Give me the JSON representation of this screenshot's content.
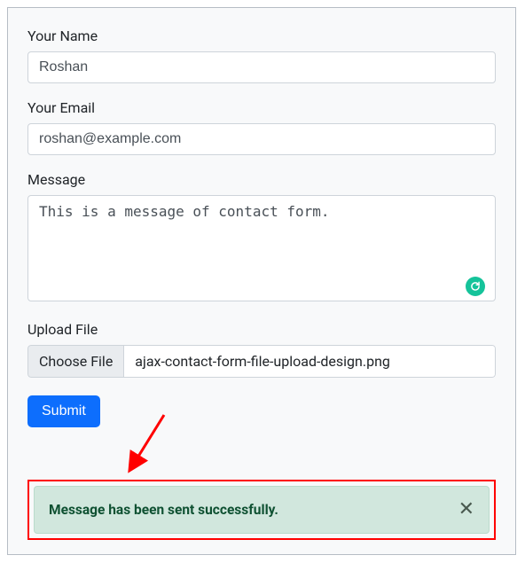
{
  "form": {
    "name": {
      "label": "Your Name",
      "value": "Roshan"
    },
    "email": {
      "label": "Your Email",
      "value": "roshan@example.com"
    },
    "message": {
      "label": "Message",
      "value": "This is a message of contact form."
    },
    "upload": {
      "label": "Upload File",
      "button": "Choose File",
      "filename": "ajax-contact-form-file-upload-design.png"
    },
    "submit": "Submit"
  },
  "alert": {
    "text": "Message has been sent successfully."
  }
}
